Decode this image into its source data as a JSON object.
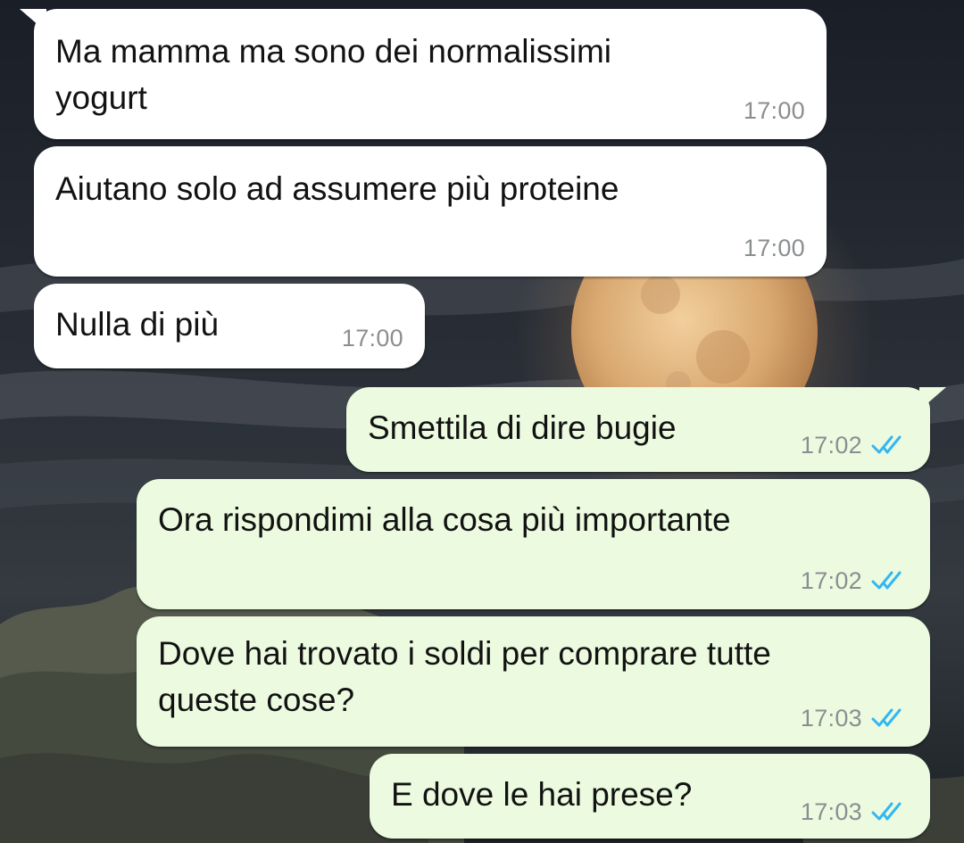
{
  "colors": {
    "incoming_bubble": "#ffffff",
    "outgoing_bubble": "#ecfbe0",
    "timestamp": "#8b8e90",
    "read_ticks": "#34b7f1"
  },
  "messages": [
    {
      "direction": "incoming",
      "text": "Ma mamma ma sono dei normalissimi\nyogurt",
      "time": "17:00"
    },
    {
      "direction": "incoming",
      "text": "Aiutano solo ad assumere più proteine",
      "time": "17:00"
    },
    {
      "direction": "incoming",
      "text": "Nulla di più",
      "time": "17:00"
    },
    {
      "direction": "outgoing",
      "text": "Smettila di dire bugie",
      "time": "17:02",
      "status_icon": "double-check-read-icon"
    },
    {
      "direction": "outgoing",
      "text": "Ora rispondimi alla cosa più importante",
      "time": "17:02",
      "status_icon": "double-check-read-icon"
    },
    {
      "direction": "outgoing",
      "text": "Dove hai trovato i soldi per comprare tutte\nqueste cose?",
      "time": "17:03",
      "status_icon": "double-check-read-icon"
    },
    {
      "direction": "outgoing",
      "text": "E dove le hai prese?",
      "time": "17:03",
      "status_icon": "double-check-read-icon"
    }
  ]
}
